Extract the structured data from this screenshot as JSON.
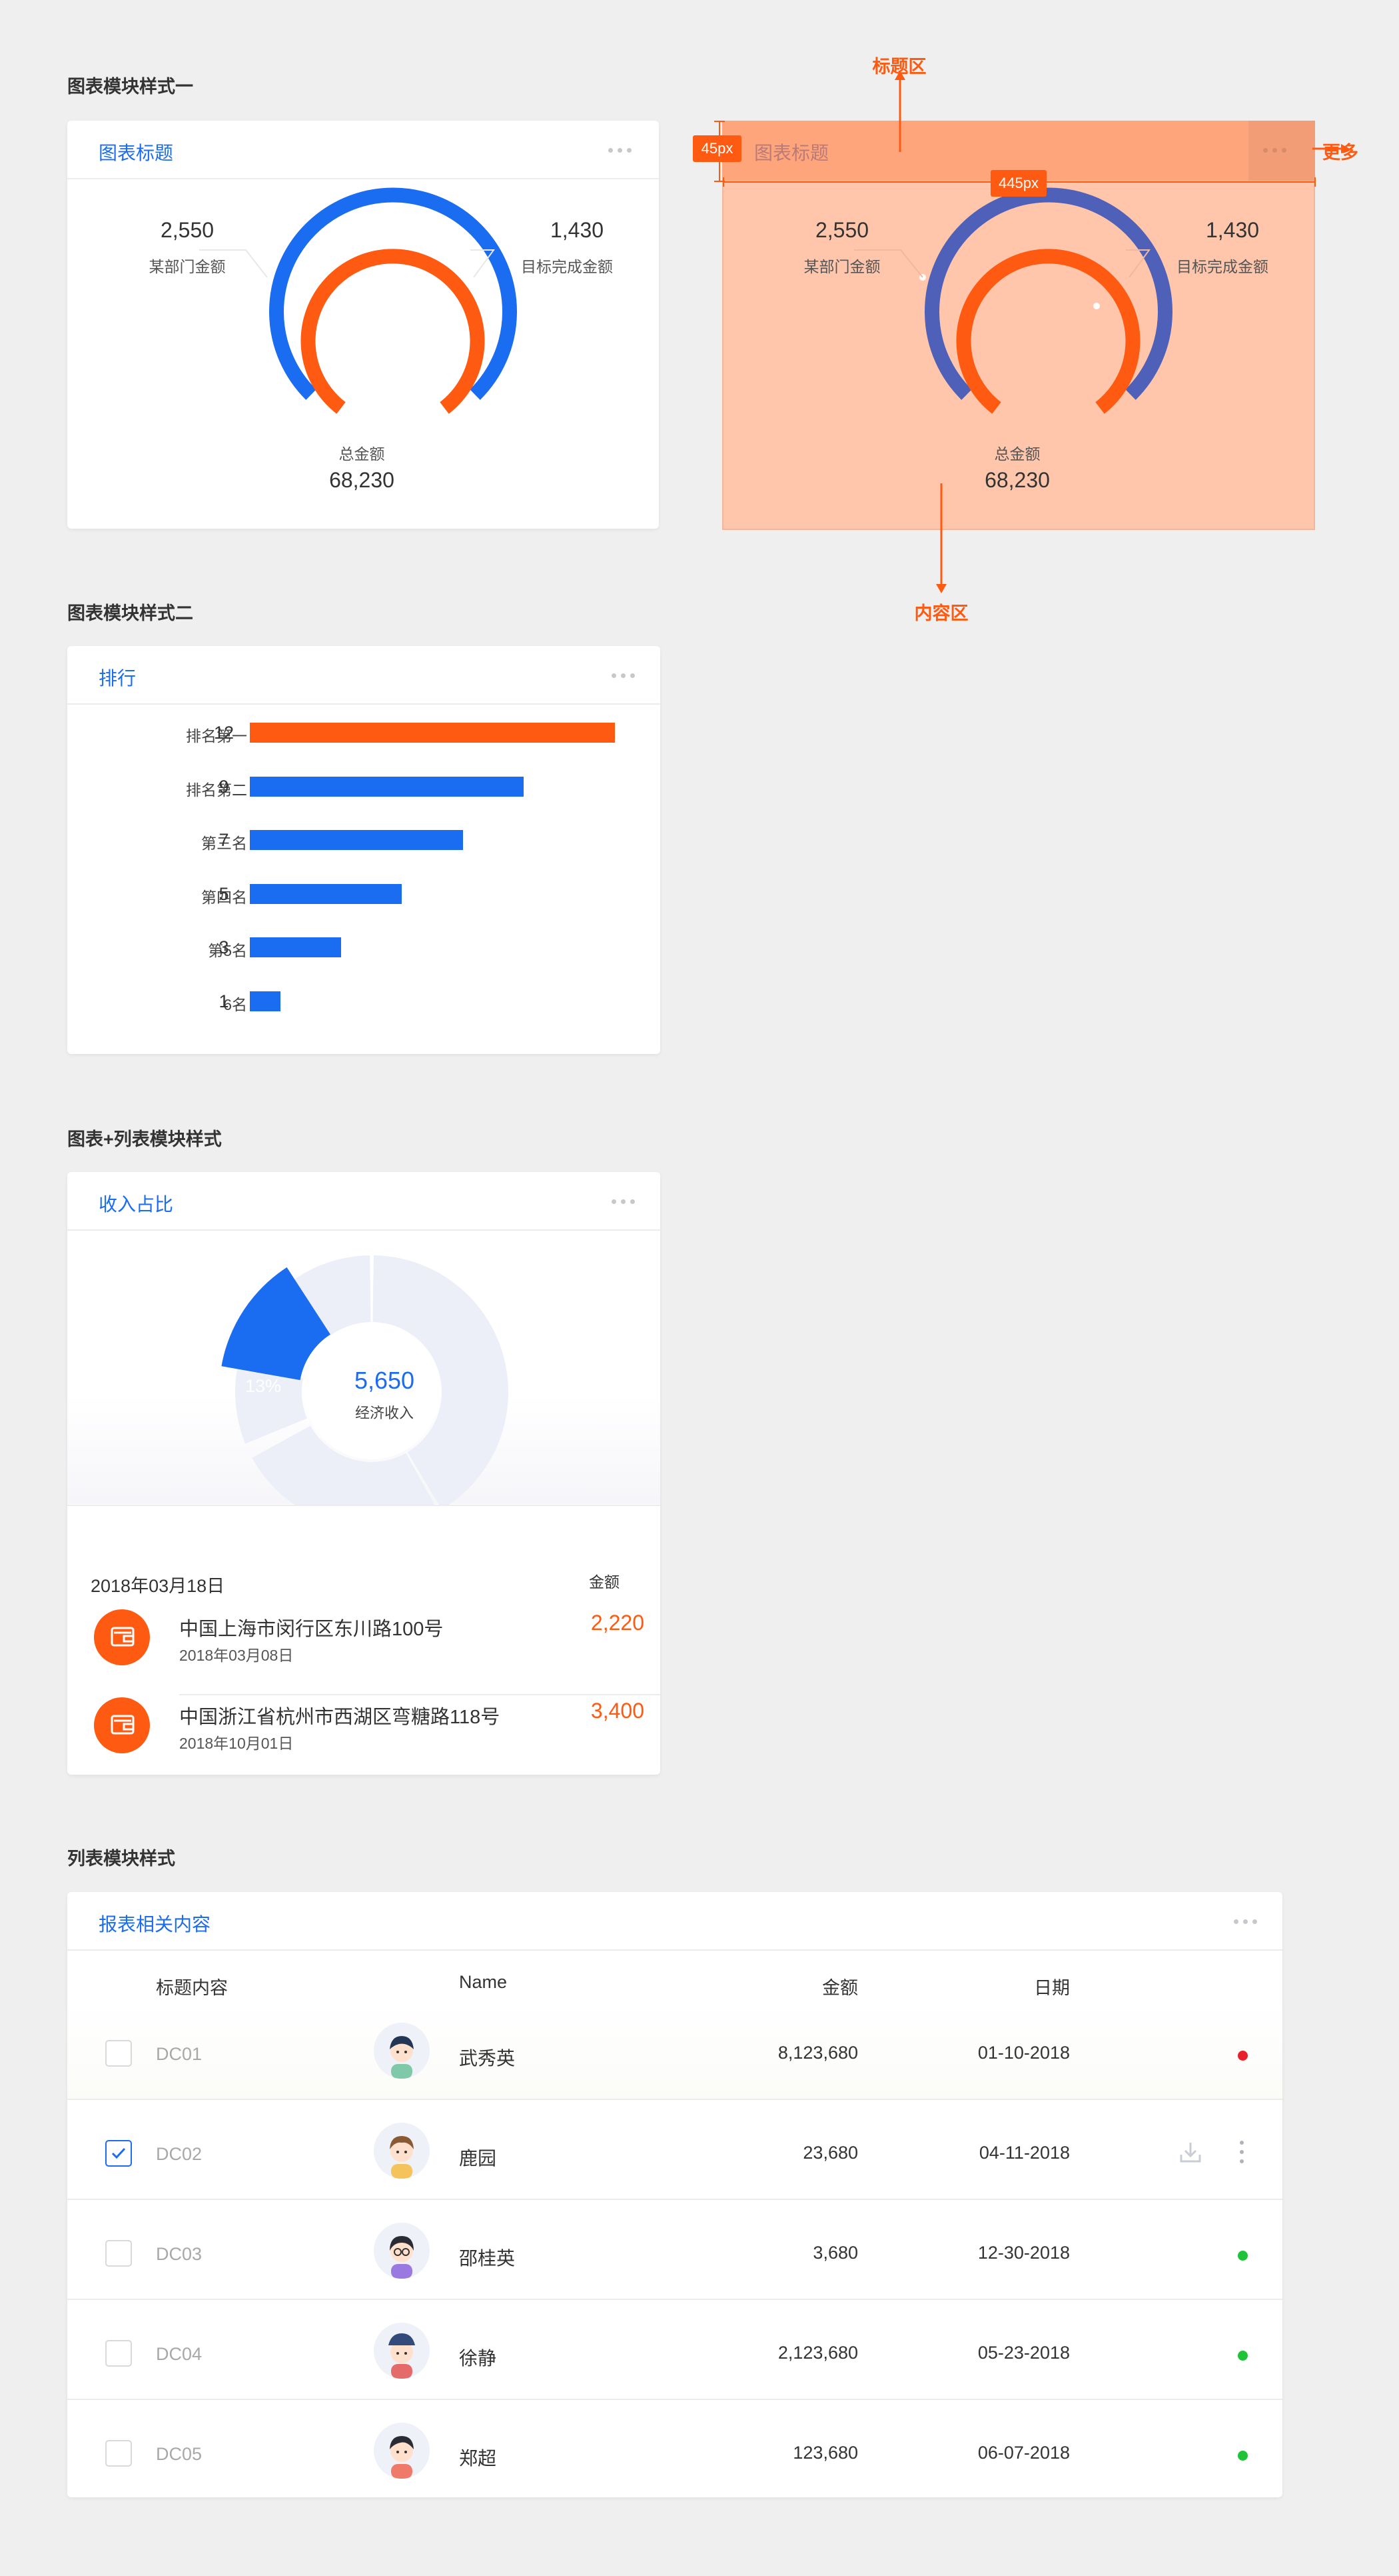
{
  "colors": {
    "primary": "#1a6cf0",
    "accent": "#ff5a12",
    "annotation": "#ff6a1a",
    "donut_rest": "#eceef8",
    "status_red": "#e8202a",
    "status_green": "#20c337"
  },
  "section1": {
    "title": "图表模块样式一"
  },
  "gauge": {
    "card_title": "图表标题",
    "left_value": "2,550",
    "left_label": "某部门金额",
    "right_value": "1,430",
    "right_label": "目标完成金额",
    "total_label": "总金额",
    "total_value": "68,230"
  },
  "spec": {
    "title_zone": "标题区",
    "content_zone": "内容区",
    "more_label": "更多",
    "height_tag": "45px",
    "width_tag": "445px"
  },
  "section2": {
    "title": "图表模块样式二"
  },
  "ranking": {
    "card_title": "排行"
  },
  "chart_data": {
    "type": "bar",
    "categories": [
      "排名第一",
      "排名第二",
      "第三名",
      "第四名",
      "第5名",
      "6名"
    ],
    "values": [
      12,
      9,
      7,
      5,
      3,
      1
    ],
    "title": "排行",
    "xlabel": "",
    "ylabel": ""
  },
  "section3": {
    "title": "图表+列表模块样式"
  },
  "income": {
    "card_title": "收入占比",
    "slice_pct": "13%",
    "slice_value": 13,
    "center_value": "5,650",
    "center_label": "经济收入",
    "list_date": "2018年03月18日",
    "list_amount_header": "金额",
    "rows": [
      {
        "address": "中国上海市闵行区东川路100号",
        "date": "2018年03月08日",
        "amount": "2,220"
      },
      {
        "address": "中国浙江省杭州市西湖区弯糖路118号",
        "date": "2018年10月01日",
        "amount": "3,400"
      }
    ]
  },
  "section4": {
    "title": "列表模块样式"
  },
  "table": {
    "card_title": "报表相关内容",
    "headers": {
      "title": "标题内容",
      "name": "Name",
      "amount": "金额",
      "date": "日期"
    },
    "rows": [
      {
        "code": "DC01",
        "name": "武秀英",
        "amount": "8,123,680",
        "date": "01-10-2018",
        "checked": false,
        "status": "red"
      },
      {
        "code": "DC02",
        "name": "鹿园",
        "amount": "23,680",
        "date": "04-11-2018",
        "checked": true,
        "status": "actions"
      },
      {
        "code": "DC03",
        "name": "邵桂英",
        "amount": "3,680",
        "date": "12-30-2018",
        "checked": false,
        "status": "green"
      },
      {
        "code": "DC04",
        "name": "徐静",
        "amount": "2,123,680",
        "date": "05-23-2018",
        "checked": false,
        "status": "green"
      },
      {
        "code": "DC05",
        "name": "郑超",
        "amount": "123,680",
        "date": "06-07-2018",
        "checked": false,
        "status": "green"
      }
    ]
  }
}
